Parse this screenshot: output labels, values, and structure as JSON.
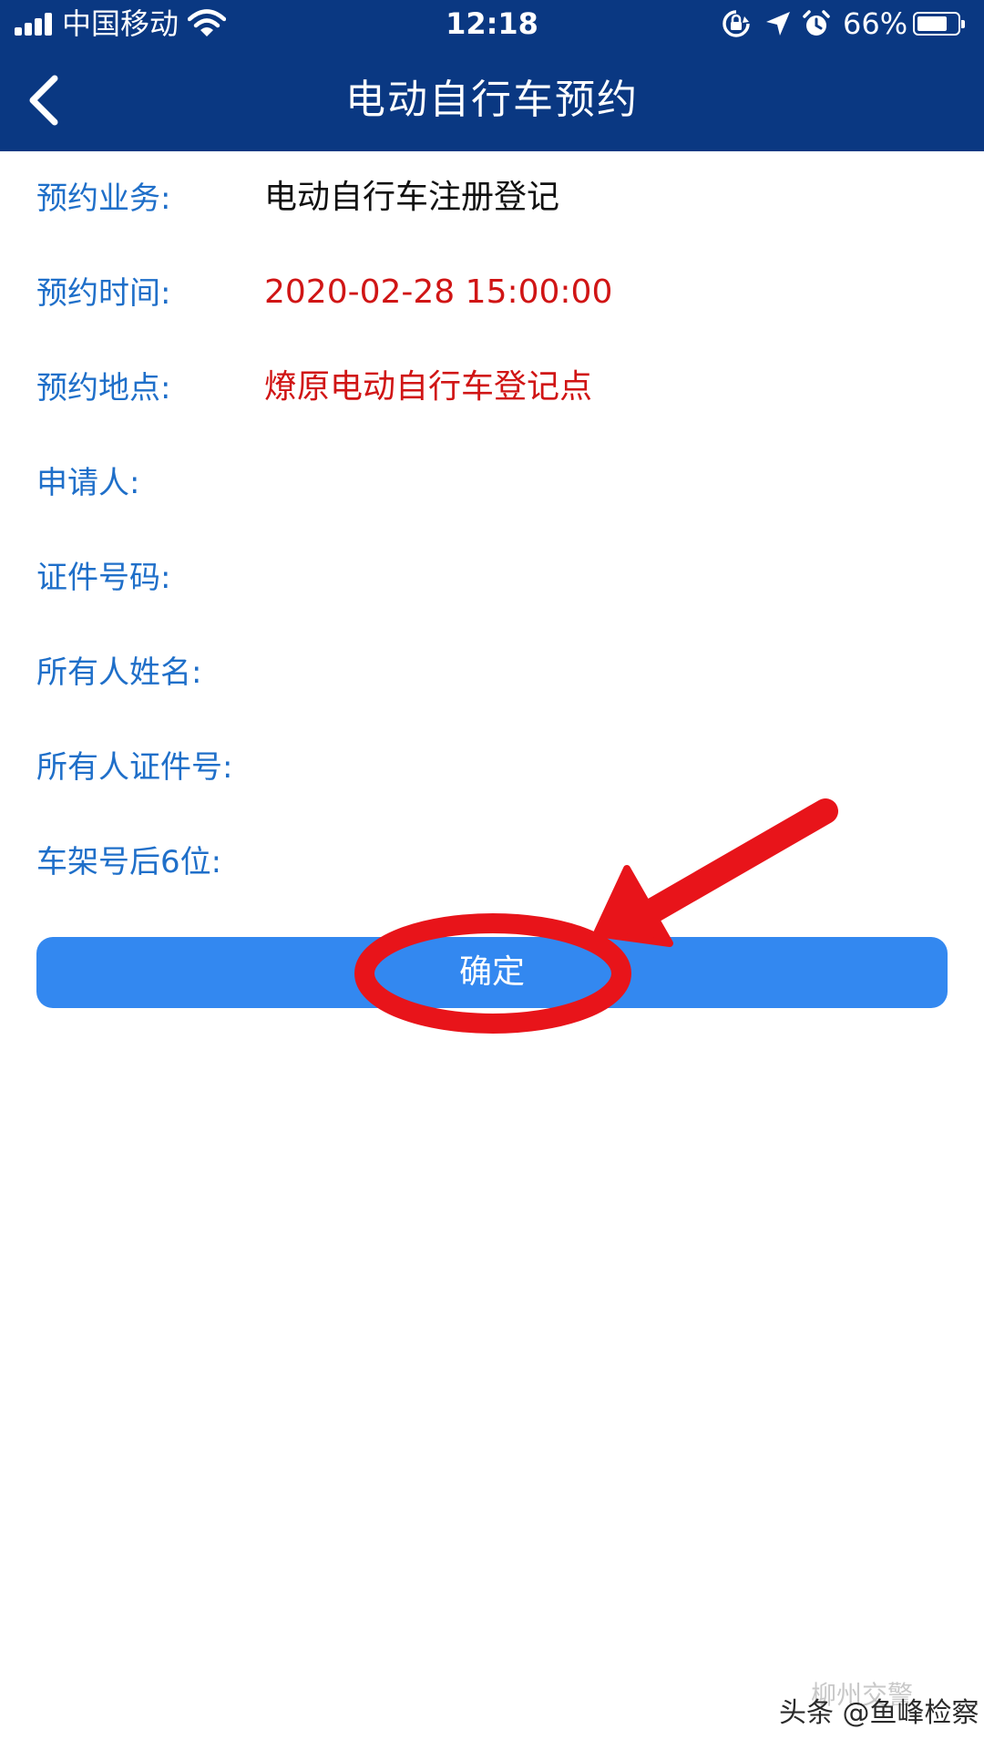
{
  "status_bar": {
    "carrier": "中国移动",
    "time": "12:18",
    "battery_percent_text": "66%",
    "battery_level": 0.66,
    "icons": [
      "signal-icon",
      "wifi-icon",
      "orientation-lock-icon",
      "location-arrow-icon",
      "alarm-icon",
      "battery-icon"
    ]
  },
  "nav": {
    "title": "电动自行车预约",
    "back_icon": "chevron-left-icon"
  },
  "form": {
    "rows": [
      {
        "label": "预约业务:",
        "value": "电动自行车注册登记",
        "value_color": "#111111"
      },
      {
        "label": "预约时间:",
        "value": "2020-02-28 15:00:00",
        "value_color": "#d01515"
      },
      {
        "label": "预约地点:",
        "value": "燎原电动自行车登记点",
        "value_color": "#d01515"
      },
      {
        "label": "申请人:",
        "value": ""
      },
      {
        "label": "证件号码:",
        "value": ""
      },
      {
        "label": "所有人姓名:",
        "value": ""
      },
      {
        "label": "所有人证件号:",
        "value": ""
      },
      {
        "label": "车架号后6位:",
        "value": ""
      }
    ]
  },
  "confirm_button": {
    "label": "确定"
  },
  "watermark": {
    "text": "头条 @鱼峰检察",
    "faint_text": "柳州交警"
  },
  "colors": {
    "header_bg": "#0a3882",
    "label_blue": "#1f6fc9",
    "value_red": "#d01515",
    "button_blue": "#3388f0",
    "annotation_red": "#e8141a"
  }
}
